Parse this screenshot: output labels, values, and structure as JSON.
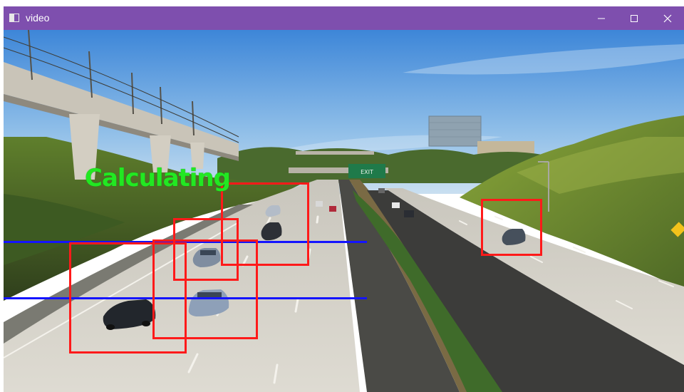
{
  "window": {
    "title": "video",
    "controls": {
      "minimize": "minimize-icon",
      "maximize": "maximize-icon",
      "close": "close-icon"
    },
    "titlebar_color": "#7e4fae"
  },
  "overlay": {
    "status_text": "Calculating",
    "status_color": "#22e822",
    "box_color": "#ff1a1a",
    "line_color": "#1414ff",
    "detections": [
      "car",
      "car",
      "car",
      "car",
      "car"
    ]
  },
  "scene": {
    "sign_text": "EXIT"
  }
}
